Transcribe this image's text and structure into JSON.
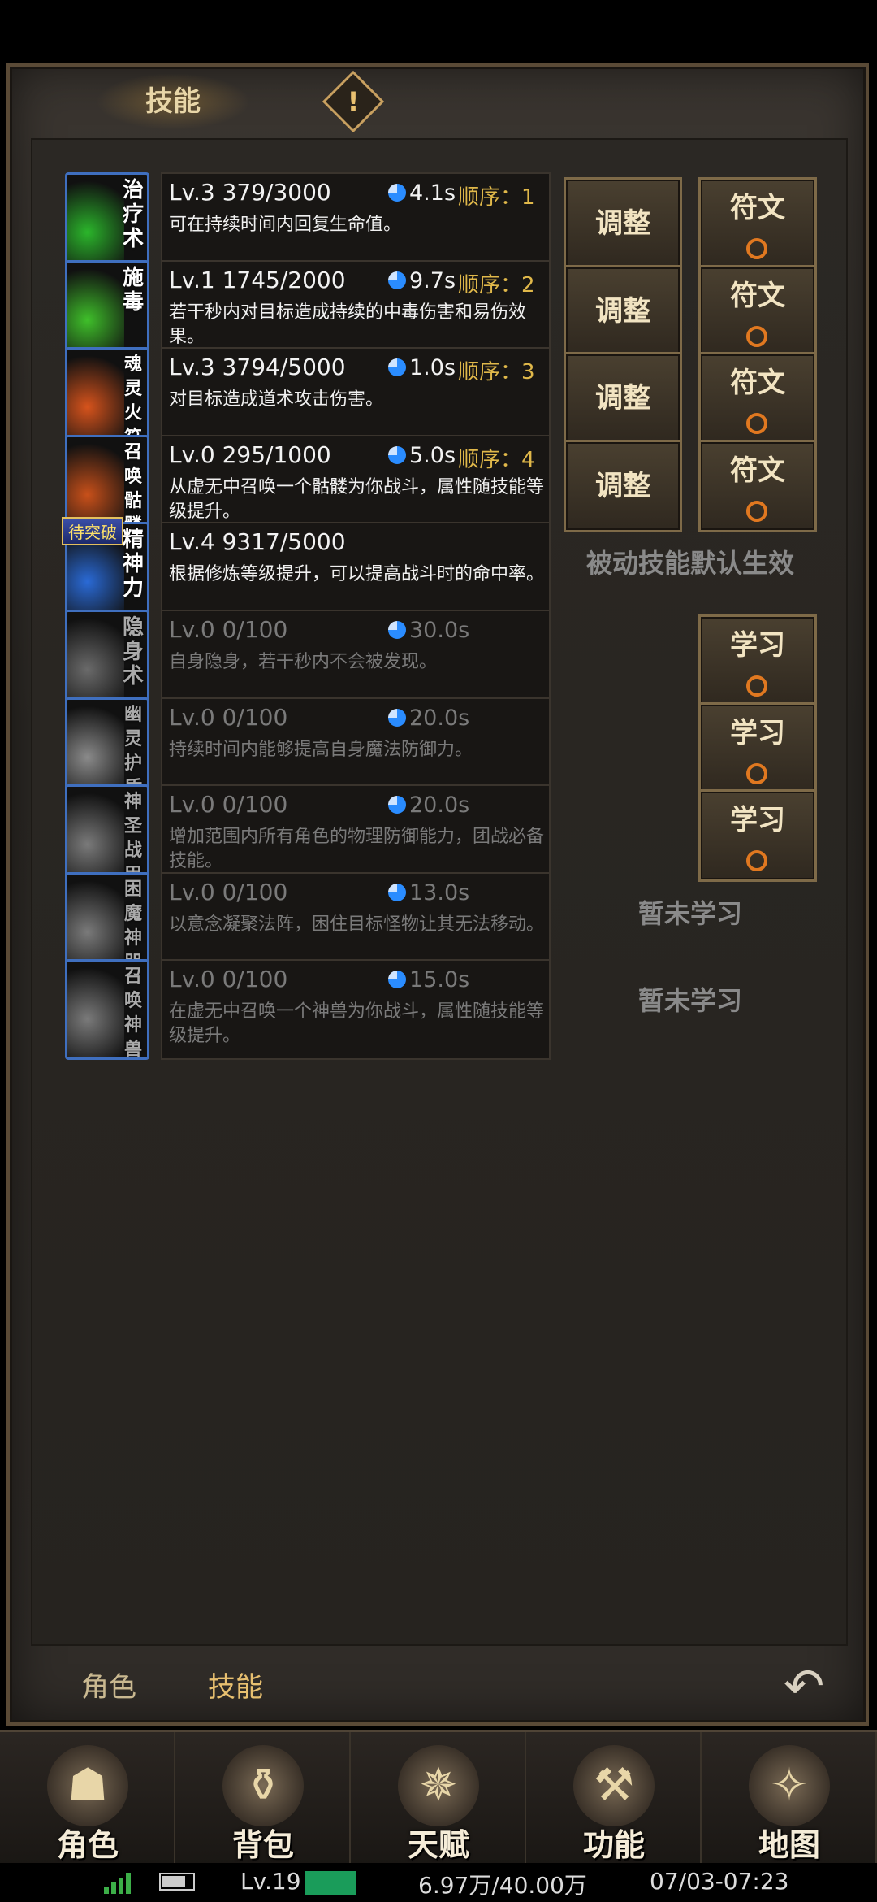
{
  "header": {
    "title": "技能",
    "warning_symbol": "!"
  },
  "skills": [
    {
      "icon_label": "治疗术",
      "level": "Lv.3 379/3000",
      "cooldown": "4.1s",
      "order_label": "顺序：",
      "order": "1",
      "desc": "可在持续时间内回复生命值。",
      "progress": 0.13,
      "art_color": "#2bb52b",
      "btn_adjust": "调整",
      "btn_rune": "符文"
    },
    {
      "icon_label": "施毒",
      "level": "Lv.1 1745/2000",
      "cooldown": "9.7s",
      "order_label": "顺序：",
      "order": "2",
      "desc": "若干秒内对目标造成持续的中毒伤害和易伤效果。",
      "progress": 0.87,
      "art_color": "#3fbf2a",
      "btn_adjust": "调整",
      "btn_rune": "符文"
    },
    {
      "icon_label": "魂灵火符",
      "level": "Lv.3 3794/5000",
      "cooldown": "1.0s",
      "order_label": "顺序：",
      "order": "3",
      "desc": "对目标造成道术攻击伤害。",
      "progress": 0.76,
      "art_color": "#d6531c",
      "btn_adjust": "调整",
      "btn_rune": "符文"
    },
    {
      "icon_label": "召唤骷髅",
      "level": "Lv.0 295/1000",
      "cooldown": "5.0s",
      "order_label": "顺序：",
      "order": "4",
      "desc": "从虚无中召唤一个骷髅为你战斗，属性随技能等级提升。",
      "progress": 0.3,
      "art_color": "#c8501a",
      "btn_adjust": "调整",
      "btn_rune": "符文"
    },
    {
      "icon_label": "精神力",
      "badge": "待突破",
      "level": "Lv.4 9317/5000",
      "desc": "根据修炼等级提升，可以提高战斗时的命中率。",
      "progress": 1.0,
      "art_color": "#2a6ad6",
      "note": "被动技能默认生效"
    },
    {
      "icon_label": "隐身术",
      "level": "Lv.0 0/100",
      "cooldown": "30.0s",
      "desc": "自身隐身，若干秒内不会被发现。",
      "art_color": "#6a6a6a",
      "btn_learn": "学习"
    },
    {
      "icon_label": "幽灵护盾",
      "level": "Lv.0 0/100",
      "cooldown": "20.0s",
      "desc": "持续时间内能够提高自身魔法防御力。",
      "art_color": "#8a8a8a",
      "btn_learn": "学习"
    },
    {
      "icon_label": "神圣战甲术",
      "level": "Lv.0 0/100",
      "cooldown": "20.0s",
      "desc": "增加范围内所有角色的物理防御能力，团战必备技能。",
      "art_color": "#7a7a7a",
      "btn_learn": "学习"
    },
    {
      "icon_label": "困魔神咒",
      "level": "Lv.0 0/100",
      "cooldown": "13.0s",
      "desc": "以意念凝聚法阵，困住目标怪物让其无法移动。",
      "art_color": "#7a7a7a",
      "note": "暂未学习"
    },
    {
      "icon_label": "召唤神兽",
      "level": "Lv.0 0/100",
      "cooldown": "15.0s",
      "desc": "在虚无中召唤一个神兽为你战斗，属性随技能等级提升。",
      "art_color": "#7a7a7a",
      "note": "暂未学习"
    }
  ],
  "tabs": {
    "character": "角色",
    "skills": "技能"
  },
  "nav": [
    {
      "label": "角色",
      "icon": "hooded-figure-icon",
      "glyph": "☗"
    },
    {
      "label": "背包",
      "icon": "backpack-icon",
      "glyph": "⚱"
    },
    {
      "label": "天赋",
      "icon": "dragon-emblem-icon",
      "glyph": "✵"
    },
    {
      "label": "功能",
      "icon": "anvil-icon",
      "glyph": "⚒"
    },
    {
      "label": "地图",
      "icon": "map-compass-icon",
      "glyph": "✧"
    }
  ],
  "status_bar": {
    "level": "Lv.19",
    "money": "6.97万/40.00万",
    "time": "07/03-07:23"
  }
}
